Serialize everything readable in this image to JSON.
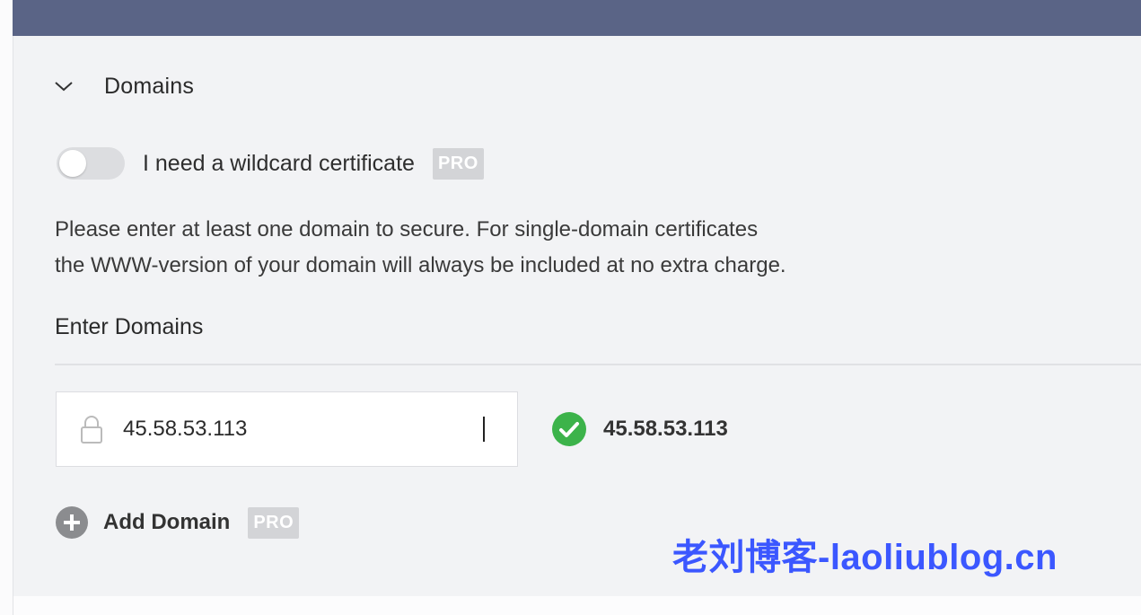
{
  "section": {
    "title": "Domains",
    "toggle_label": "I need a wildcard certificate",
    "toggle_on": false,
    "pro_badge": "PRO",
    "help_line1": "Please enter at least one domain to secure. For single-domain certificates",
    "help_line2": "the WWW-version of your domain will always be included at no extra charge.",
    "enter_label": "Enter Domains"
  },
  "domain_entry": {
    "value": "45.58.53.113",
    "verified_value": "45.58.53.113"
  },
  "add_domain": {
    "label": "Add Domain",
    "pro_badge": "PRO"
  },
  "watermark": "老刘博客-laoliublog.cn",
  "colors": {
    "top_bar": "#5a6486",
    "check_green": "#3cb34a",
    "watermark_blue": "#3b57ff"
  }
}
